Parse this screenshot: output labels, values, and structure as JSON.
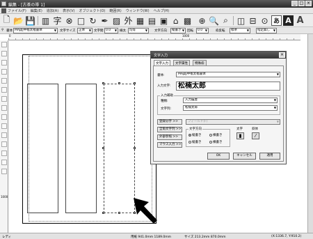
{
  "window": {
    "title": "編集 - [古茶の帯 1]"
  },
  "menu": [
    "ファイル(F)",
    "編集(E)",
    "追加(A)",
    "表示(V)",
    "オブジェクト(O)",
    "範囲(R)",
    "ウィンドウ(W)",
    "ヘルプ(H)"
  ],
  "toolbar": {
    "font_label": "書体",
    "font_value": "MAJ超中楷太楷書体",
    "text_size_label": "文字サイズ",
    "text_size_value": "正体",
    "text_spacing_label": "文字間",
    "text_spacing_value": "0.0",
    "line_spacing_label": "線太",
    "line_spacing_value": "均等",
    "text_dir_label": "文字方向",
    "text_dir_value": "縦書き",
    "rotation_label": "回転",
    "rotation_value": "0.0",
    "frame_label": "枠反転",
    "frame_value": "標準",
    "designate_label": "指定無し"
  },
  "ruler": {
    "h": [
      "0",
      "1000"
    ],
    "v": [
      "0",
      "1000"
    ]
  },
  "dialog": {
    "title": "文字入力",
    "tabs": [
      "文字入力",
      "文字属性",
      "特殊枠"
    ],
    "font_label": "書体:",
    "font_value": "MAJ超中楷太楷書体",
    "input_label": "入力文字:",
    "input_value": "松楠太郎",
    "assist_group": "入力補助",
    "type_label": "種類:",
    "type_value": "入力履歴",
    "string_label": "文字列:",
    "string_value": "松楠太郎",
    "btn_reg": "登録分字 >>",
    "btn_all": "全角文字列 >>",
    "btn_ext": "外部参照 >>",
    "btn_mouse": "マウス入力 >>",
    "field_label": "フィールド(F)",
    "dir_group": "文字方向",
    "r_vert": "縦書き",
    "r_horiz": "横書き",
    "r_vert2": "縦書き",
    "r_horiz2": "横書き",
    "bold_label": "太字",
    "slant_label": "斜体",
    "ok": "OK",
    "cancel": "キャンセル",
    "apply": "適用"
  },
  "status": {
    "ready": "レディ",
    "size": "用紙 941.0mm 1189.0mm",
    "obj": "サイズ 213.2mm 870.0mm",
    "coord": "(X:1336.7, Y:910.2)"
  }
}
